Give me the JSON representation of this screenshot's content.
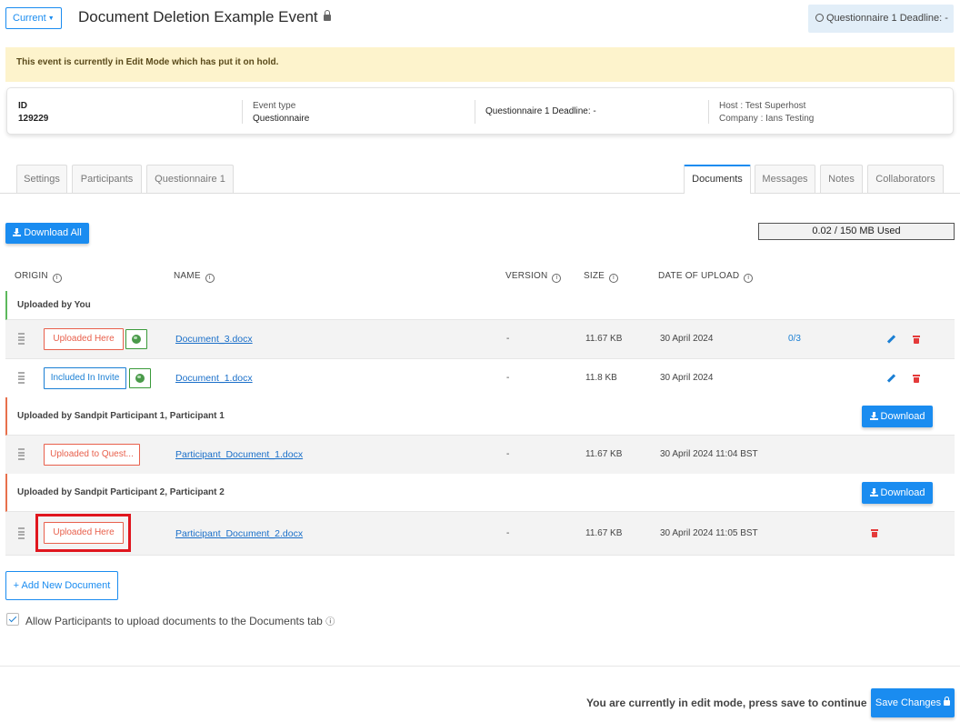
{
  "header": {
    "current_label": "Current",
    "title": "Document Deletion Example Event",
    "deadline_badge": "Questionnaire 1 Deadline: -"
  },
  "banner": "This event is currently in Edit Mode which has put it on hold.",
  "info": {
    "id_label": "ID",
    "id_value": "129229",
    "event_type_label": "Event type",
    "event_type_value": "Questionnaire",
    "deadline": "Questionnaire 1 Deadline: -",
    "host": "Host : Test Superhost",
    "company": "Company : Ians Testing"
  },
  "tabs_left": [
    "Settings",
    "Participants",
    "Questionnaire 1"
  ],
  "tabs_right": [
    "Documents",
    "Messages",
    "Notes",
    "Collaborators"
  ],
  "toolbar": {
    "download_all": "Download All",
    "storage": "0.02 / 150 MB Used"
  },
  "columns": {
    "origin": "ORIGIN",
    "name": "NAME",
    "version": "VERSION",
    "size": "SIZE",
    "date": "DATE OF UPLOAD"
  },
  "groups": [
    {
      "label": "Uploaded by You",
      "color": "#5cb85c"
    },
    {
      "label": "Uploaded by Sandpit Participant 1, Participant 1",
      "color": "#e8704c",
      "download": "Download"
    },
    {
      "label": "Uploaded by Sandpit Participant 2, Participant 2",
      "color": "#e8704c",
      "download": "Download"
    }
  ],
  "rows": [
    {
      "origin": "Uploaded Here",
      "name": "Document_3.docx",
      "version": "-",
      "size": "11.67 KB",
      "date": "30 April 2024",
      "count": "0/3"
    },
    {
      "origin": "Included In Invite",
      "name": "Document_1.docx",
      "version": "-",
      "size": "11.8 KB",
      "date": "30 April 2024"
    },
    {
      "origin": "Uploaded to Quest...",
      "name": "Participant_Document_1.docx",
      "version": "-",
      "size": "11.67 KB",
      "date": "30 April 2024 11:04 BST"
    },
    {
      "origin": "Uploaded Here",
      "name": "Participant_Document_2.docx",
      "version": "-",
      "size": "11.67 KB",
      "date": "30 April 2024 11:05 BST"
    }
  ],
  "add_document": "+ Add New Document",
  "allow_upload_label": "Allow Participants to upload documents to the Documents tab",
  "allow_upload_info": "ⓘ",
  "footer": {
    "message": "You are currently in edit mode, press save to continue",
    "save": "Save Changes"
  },
  "colors": {
    "accent": "#1a8cf0",
    "danger": "#e43a3a",
    "banner_bg": "#fdf3cc"
  }
}
